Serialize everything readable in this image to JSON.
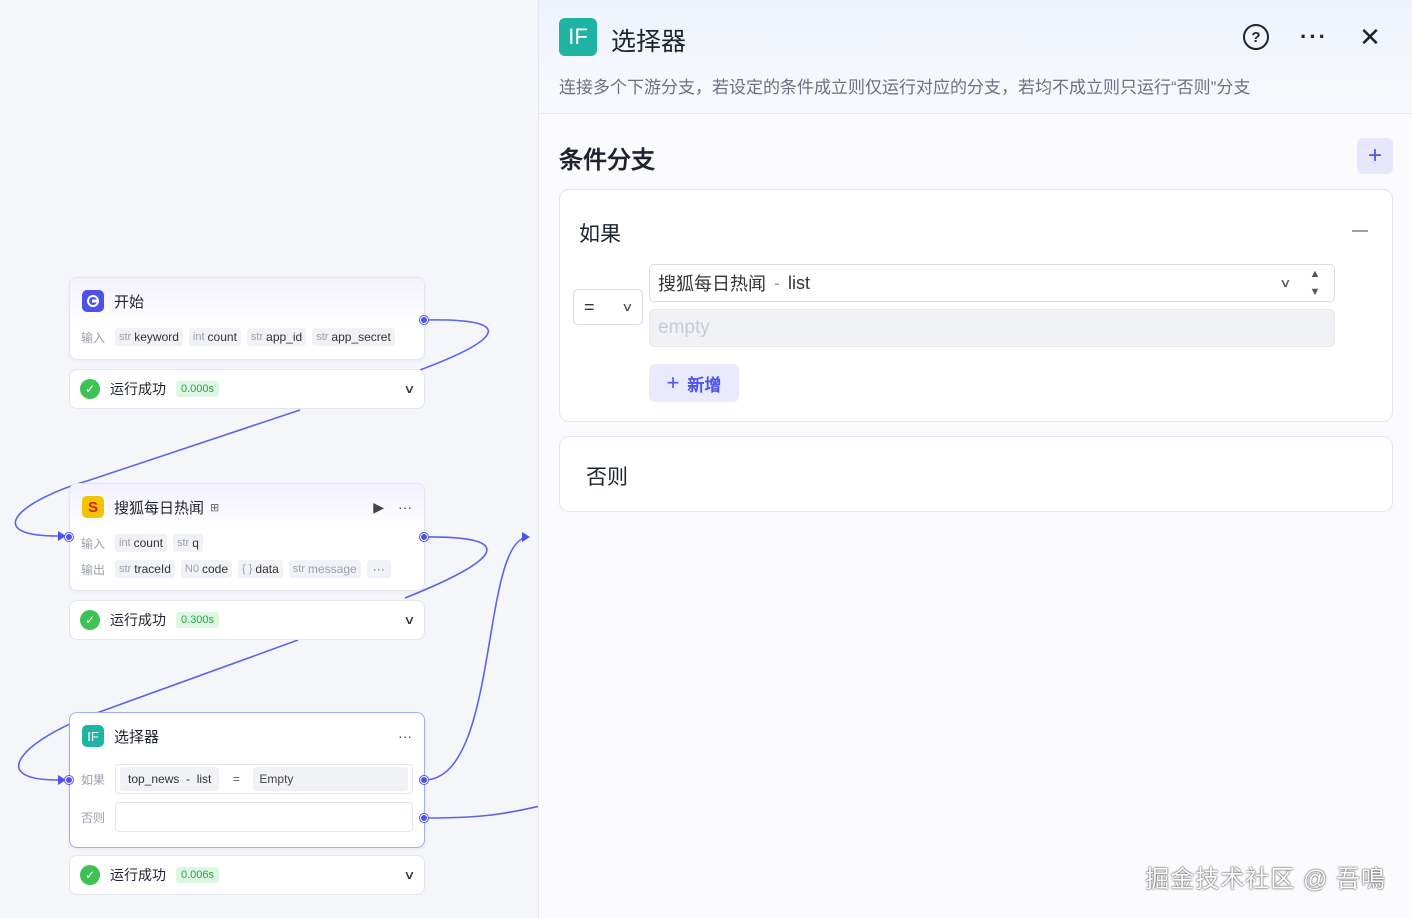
{
  "canvas": {
    "start_node": {
      "title": "开始",
      "input_label": "输入",
      "inputs": [
        {
          "type": "str",
          "name": "keyword"
        },
        {
          "type": "int",
          "name": "count"
        },
        {
          "type": "str",
          "name": "app_id"
        },
        {
          "type": "str",
          "name": "app_secret"
        }
      ],
      "status": "运行成功",
      "time": "0.000s"
    },
    "sohu_node": {
      "title": "搜狐每日热闻",
      "input_label": "输入",
      "output_label": "输出",
      "inputs": [
        {
          "type": "int",
          "name": "count"
        },
        {
          "type": "str",
          "name": "q"
        }
      ],
      "outputs": [
        {
          "type": "str",
          "name": "traceId"
        },
        {
          "type": "N0",
          "name": "code"
        },
        {
          "type": "{ }",
          "name": "data"
        },
        {
          "type": "str",
          "name": "message"
        }
      ],
      "more": "···",
      "status": "运行成功",
      "time": "0.300s"
    },
    "selector_node": {
      "title": "选择器",
      "if_label": "如果",
      "else_label": "否则",
      "condition_ref": "top_news",
      "condition_sep": "-",
      "condition_field": "list",
      "condition_op": "=",
      "condition_value": "Empty",
      "status": "运行成功",
      "time": "0.006s"
    }
  },
  "panel": {
    "icon_text": "IF",
    "title": "选择器",
    "description": "连接多个下游分支，若设定的条件成立则仅运行对应的分支，若均不成立则只运行“否则”分支",
    "section_title": "条件分支",
    "if_card": {
      "title": "如果",
      "operator": "=",
      "ref_node": "搜狐每日热闻",
      "ref_sep": "-",
      "ref_field": "list",
      "value_placeholder": "empty",
      "add_label": "新增"
    },
    "else_card": {
      "title": "否则"
    }
  },
  "watermark": "掘金技术社区 @ 吾鳴",
  "colors": {
    "accent": "#4d53e8",
    "success": "#3ec254",
    "if_icon": "#1fb3a3",
    "start_icon": "#4d53e8",
    "sohu_icon": "#f5c400"
  }
}
